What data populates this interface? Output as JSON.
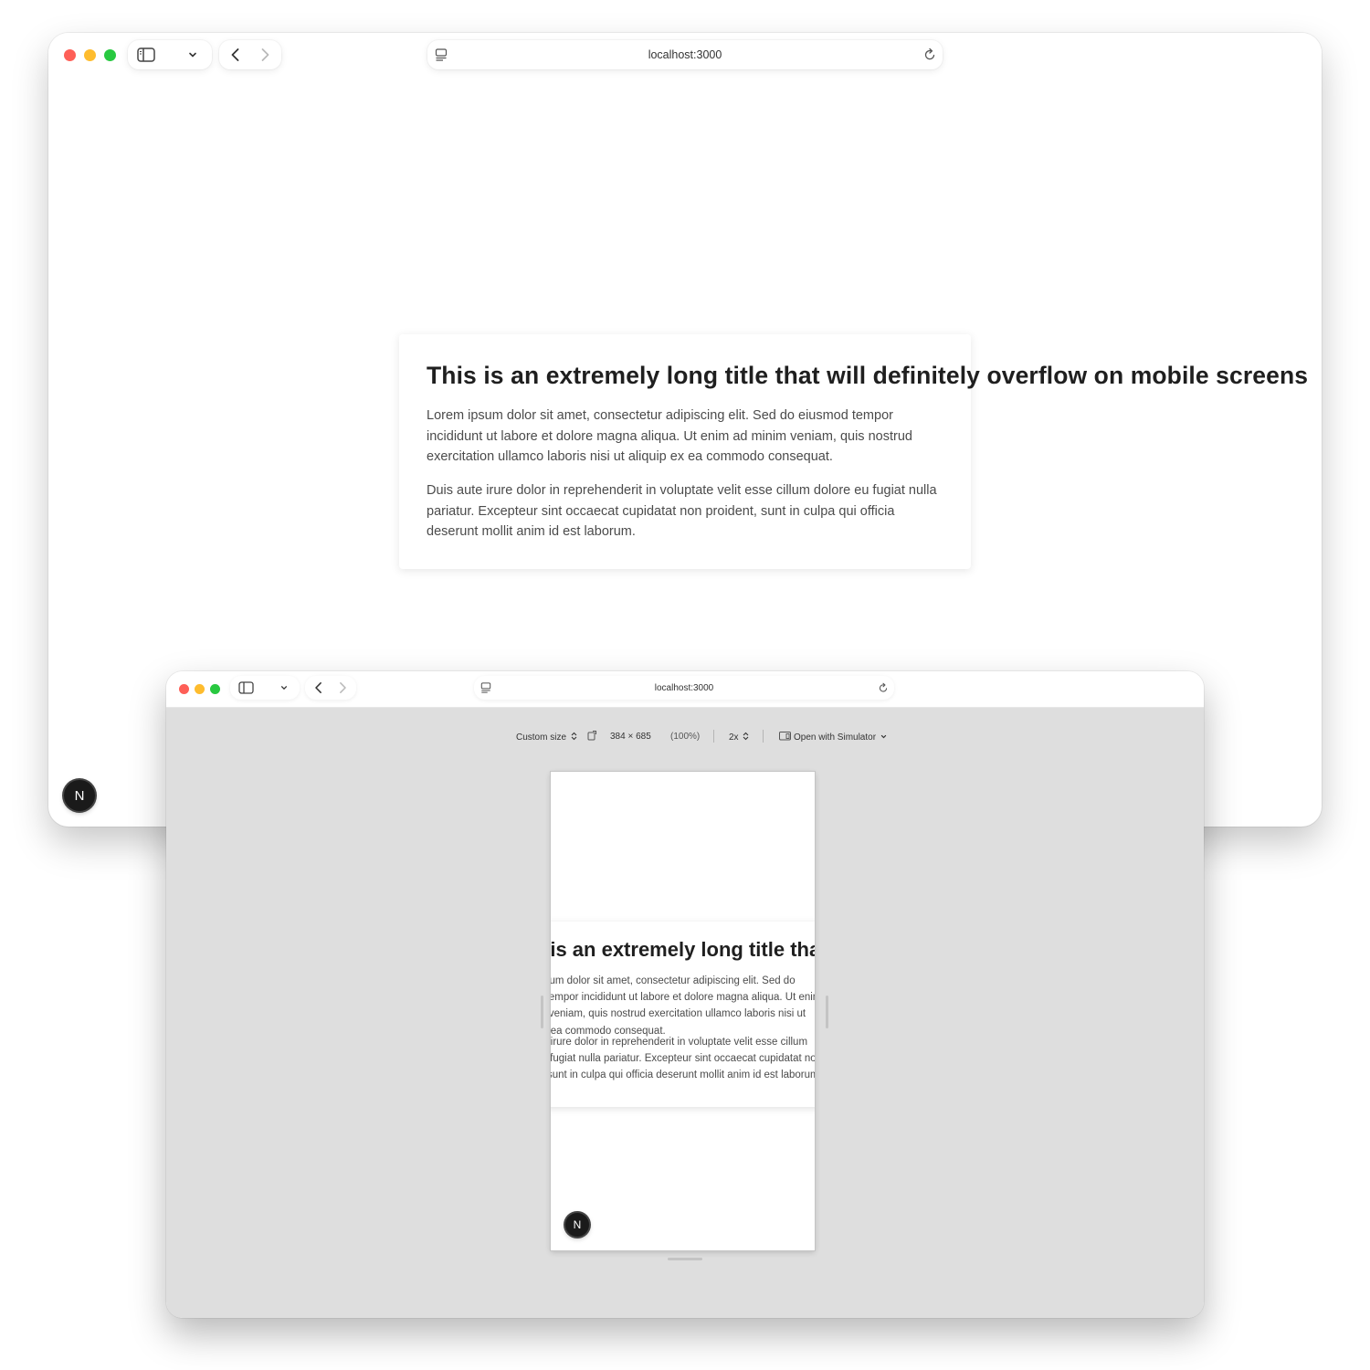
{
  "main_window": {
    "url": "localhost:3000",
    "card": {
      "title": "This is an extremely long title that will definitely overflow on mobile screens",
      "paragraph1": "Lorem ipsum dolor sit amet, consectetur adipiscing elit. Sed do eiusmod tempor incididunt ut labore et dolore magna aliqua. Ut enim ad minim veniam, quis nostrud exercitation ullamco laboris nisi ut aliquip ex ea commodo consequat.",
      "paragraph2": "Duis aute irure dolor in reprehenderit in voluptate velit esse cillum dolore eu fugiat nulla pariatur. Excepteur sint occaecat cupidatat non proident, sunt in culpa qui officia deserunt mollit anim id est laborum."
    },
    "nextjs_badge": "N"
  },
  "front_window": {
    "url": "localhost:3000",
    "responsive_toolbar": {
      "device": "Custom size",
      "dimensions": "384 × 685",
      "zoom": "(100%)",
      "pixel_ratio": "2x",
      "simulator_label": "Open with Simulator"
    },
    "phone": {
      "title": "This is an extremely long title that will definitely overflow on mobile screens",
      "paragraph1": "Lorem ipsum dolor sit amet, consectetur adipiscing elit. Sed do eiusmod tempor incididunt ut labore et dolore magna aliqua. Ut enim ad minim veniam, quis nostrud exercitation ullamco laboris nisi ut aliquip ex ea commodo consequat.",
      "paragraph2": "Duis aute irure dolor in reprehenderit in voluptate velit esse cillum dolore eu fugiat nulla pariatur. Excepteur sint occaecat cupidatat non proident, sunt in culpa qui officia deserunt mollit anim id est laborum.",
      "nextjs_badge": "N"
    }
  },
  "icons": {
    "close": "red-traffic-light",
    "minimize": "yellow-traffic-light",
    "zoom": "green-traffic-light",
    "sidebar": "sidebar-icon",
    "chevron": "chevron-down-icon",
    "back": "back-arrow-icon",
    "forward": "forward-arrow-icon",
    "page_settings": "page-settings-icon",
    "reload": "reload-icon",
    "rotate": "rotate-icon",
    "simulator": "simulator-icon",
    "stepper": "stepper-icon"
  }
}
